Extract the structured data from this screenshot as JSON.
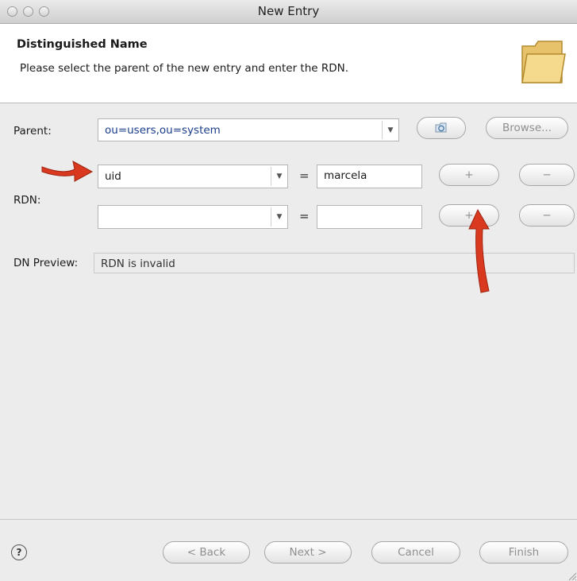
{
  "window": {
    "title": "New Entry"
  },
  "header": {
    "title": "Distinguished Name",
    "description": "Please select the parent of the new entry and enter the RDN.",
    "icon": "folder-icon"
  },
  "form": {
    "parent_label": "Parent:",
    "parent_value": "ou=users,ou=system",
    "browse_label": "Browse...",
    "rdn_label": "RDN:",
    "rdn_rows": [
      {
        "attribute": "uid",
        "value": "marcela"
      },
      {
        "attribute": "",
        "value": ""
      }
    ],
    "equals": "=",
    "add_label": "+",
    "remove_label": "−",
    "dn_preview_label": "DN Preview:",
    "dn_preview_value": "RDN is invalid"
  },
  "footer": {
    "help": "?",
    "back_label": "< Back",
    "next_label": "Next >",
    "cancel_label": "Cancel",
    "finish_label": "Finish"
  },
  "colors": {
    "annotation_arrow": "#d9391f",
    "header_bg": "#ffffff",
    "dialog_bg": "#ececec"
  }
}
